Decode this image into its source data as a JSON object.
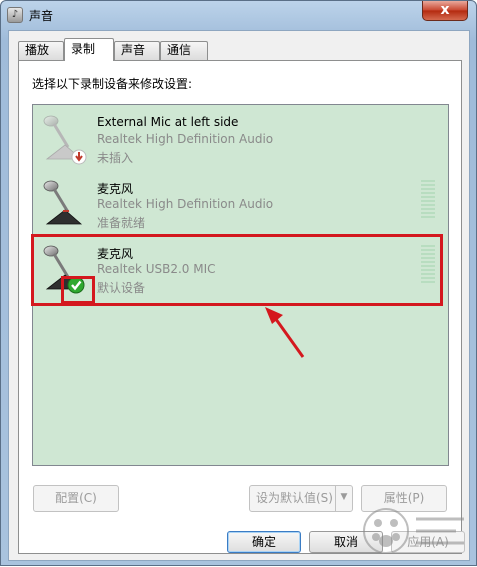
{
  "window": {
    "title": "声音",
    "close_label": "x"
  },
  "tabs": [
    {
      "label": "播放",
      "active": false
    },
    {
      "label": "录制",
      "active": true
    },
    {
      "label": "声音",
      "active": false
    },
    {
      "label": "通信",
      "active": false
    }
  ],
  "instruction": "选择以下录制设备来修改设置:",
  "devices": [
    {
      "name": "External Mic at left side",
      "description": "Realtek High Definition Audio",
      "status": "未插入",
      "icon": "microphone-unplugged-icon"
    },
    {
      "name": "麦克风",
      "description": "Realtek High Definition Audio",
      "status": "准备就绪",
      "icon": "microphone-icon"
    },
    {
      "name": "麦克风",
      "description": "Realtek USB2.0 MIC",
      "status": "默认设备",
      "icon": "microphone-default-icon",
      "selected_annotation": true
    }
  ],
  "buttons": {
    "configure": "配置(C)",
    "set_default": "设为默认值(S)",
    "properties": "属性(P)",
    "ok": "确定",
    "cancel": "取消",
    "apply": "应用(A)"
  },
  "colors": {
    "list_background": "#cfe7d3",
    "annotation_red": "#d4181e",
    "check_green": "#2ea82e"
  }
}
